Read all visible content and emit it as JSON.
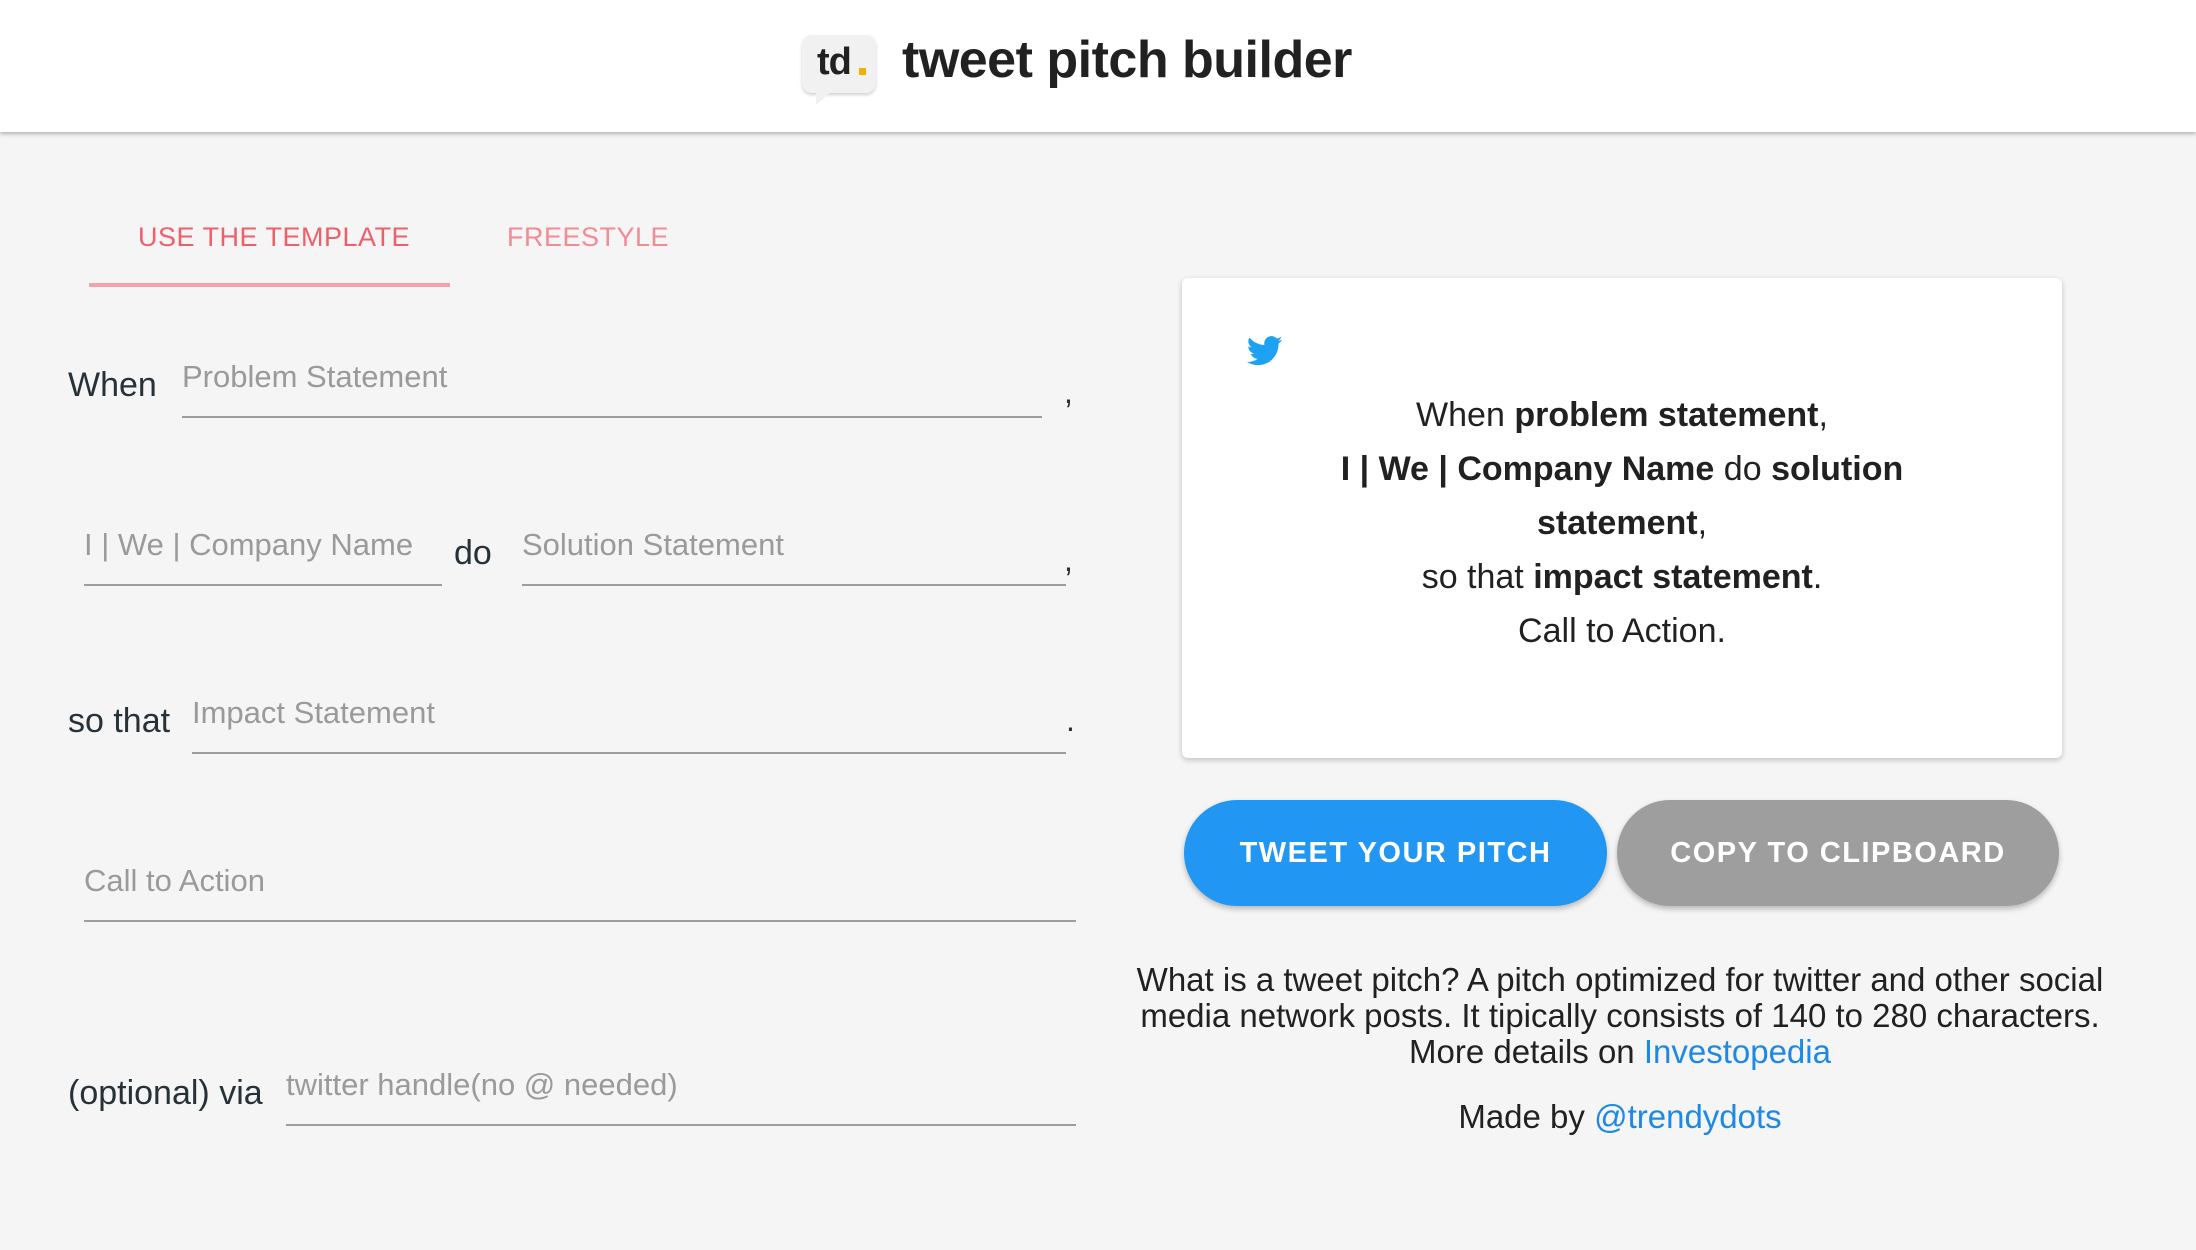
{
  "header": {
    "logo_text": "td",
    "title": "tweet pitch builder"
  },
  "tabs": [
    {
      "label": "USE THE TEMPLATE",
      "active": true
    },
    {
      "label": "FREESTYLE",
      "active": false
    }
  ],
  "form": {
    "when_label": "When",
    "do_label": "do",
    "so_that_label": "so that",
    "via_label": "(optional) via",
    "comma": ",",
    "period": ".",
    "problem": {
      "value": "",
      "placeholder": "Problem Statement"
    },
    "who": {
      "value": "",
      "placeholder": "I | We | Company Name"
    },
    "solution": {
      "value": "",
      "placeholder": "Solution Statement"
    },
    "impact": {
      "value": "",
      "placeholder": "Impact Statement"
    },
    "cta": {
      "value": "",
      "placeholder": "Call to Action"
    },
    "handle": {
      "value": "",
      "placeholder": "twitter handle(no @ needed)"
    }
  },
  "preview": {
    "icon": "twitter-bird-icon",
    "when": "When",
    "problem": "problem statement",
    "comma": ",",
    "who": "I | We | Company Name",
    "do": "do",
    "solution": "solution statement",
    "so_that": "so that",
    "impact": "impact statement",
    "period": ".",
    "cta": "Call to Action."
  },
  "buttons": {
    "tweet": "TWEET YOUR PITCH",
    "copy": "COPY TO CLIPBOARD"
  },
  "info": {
    "text": "What is a tweet pitch? A pitch optimized for twitter and other social media network posts. It tipically consists of 140 to 280 characters. More details on",
    "link": "Investopedia",
    "made_by": "Made by",
    "author": "@trendydots"
  },
  "colors": {
    "accent": "#ee5f6a",
    "twitter_blue": "#2196f3",
    "gray_button": "#9e9e9e",
    "link": "#1e88e5"
  }
}
